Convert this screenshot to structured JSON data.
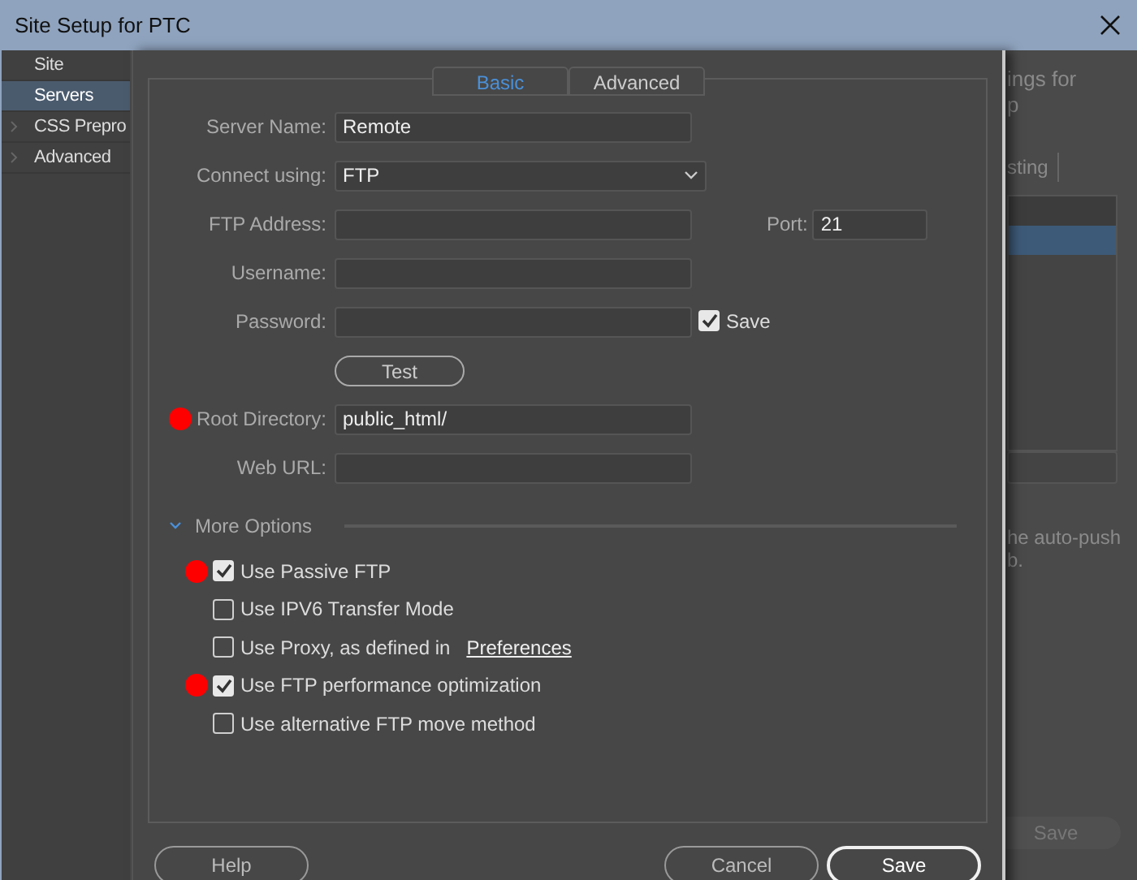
{
  "window": {
    "title": "Site Setup for PTC"
  },
  "sidebar": {
    "items": [
      {
        "label": "Site",
        "selected": false,
        "expandable": false
      },
      {
        "label": "Servers",
        "selected": true,
        "expandable": false
      },
      {
        "label": "CSS Prepro",
        "selected": false,
        "expandable": true
      },
      {
        "label": "Advanced",
        "selected": false,
        "expandable": true
      }
    ]
  },
  "background": {
    "heading": [
      "ings for",
      "p"
    ],
    "tab": "sting",
    "note": [
      "he auto-push",
      "b."
    ],
    "save_button": "Save"
  },
  "dialog": {
    "tabs": [
      {
        "label": "Basic",
        "selected": true
      },
      {
        "label": "Advanced",
        "selected": false
      }
    ],
    "rows": [
      {
        "kind": "text",
        "label": "Server Name:",
        "value": "Remote",
        "marked": false
      },
      {
        "kind": "select",
        "label": "Connect using:",
        "value": "FTP",
        "marked": false
      },
      {
        "kind": "text",
        "label": "FTP Address:",
        "marked": false,
        "port": {
          "label": "Port:",
          "value": "21"
        }
      },
      {
        "kind": "text",
        "label": "Username:",
        "marked": false
      },
      {
        "kind": "password",
        "label": "Password:",
        "marked": false,
        "save": {
          "label": "Save",
          "checked": true
        }
      },
      {
        "kind": "button",
        "label": "Test"
      },
      {
        "kind": "text",
        "label": "Root Directory:",
        "value": "public_html/",
        "marked": true
      },
      {
        "kind": "text",
        "label": "Web URL:",
        "marked": false
      }
    ],
    "more_options": {
      "label": "More Options",
      "expanded": true
    },
    "options": [
      {
        "label": "Use Passive FTP",
        "checked": true,
        "marked": true
      },
      {
        "label": "Use IPV6 Transfer Mode",
        "checked": false,
        "marked": false
      },
      {
        "label": "Use Proxy, as defined in",
        "checked": false,
        "marked": false,
        "link": "Preferences"
      },
      {
        "label": "Use FTP performance optimization",
        "checked": true,
        "marked": true
      },
      {
        "label": "Use alternative FTP move method",
        "checked": false,
        "marked": false
      }
    ],
    "buttons": [
      {
        "label": "Help",
        "kind": "secondary"
      },
      {
        "label": "Cancel",
        "kind": "secondary"
      },
      {
        "label": "Save",
        "kind": "primary"
      }
    ]
  }
}
